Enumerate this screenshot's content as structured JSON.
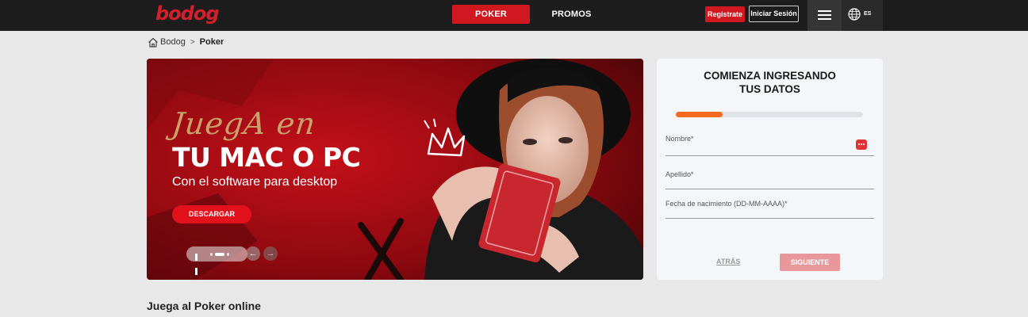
{
  "header": {
    "logo": "bodog",
    "nav": [
      {
        "label": "POKER",
        "active": true
      },
      {
        "label": "PROMOS",
        "active": false
      }
    ],
    "register_label": "Registrate",
    "login_label": "Iniciar Sesión",
    "language": "ES",
    "accent_color": "#d1171f"
  },
  "breadcrumb": {
    "home": "Bodog",
    "separator": ">",
    "current": "Poker"
  },
  "banner": {
    "script_text": "JuegA en",
    "title": "TU MAC O PC",
    "subtitle": "Con el software para desktop",
    "cta_label": "DESCARGAR",
    "prev_arrow": "←",
    "next_arrow": "→"
  },
  "registration": {
    "title_line1": "COMIENZA INGRESANDO",
    "title_line2": "TUS DATOS",
    "progress": 0.25,
    "fields": [
      {
        "label": "Nombre*"
      },
      {
        "label": "Apellido*"
      },
      {
        "label": "Fecha de nacimiento (DD-MM-AAAA)*"
      }
    ],
    "back_label": "ATRÁS",
    "next_label": "SIGUIENTE",
    "progress_color": "#f36a1f"
  },
  "section": {
    "heading": "Juega al Poker online"
  },
  "icons": {
    "home": "home-icon",
    "menu": "hamburger-menu-icon",
    "language": "globe-icon",
    "password_manager": "password-dots-icon",
    "pause": "pause-icon",
    "crown": "crown-icon"
  }
}
